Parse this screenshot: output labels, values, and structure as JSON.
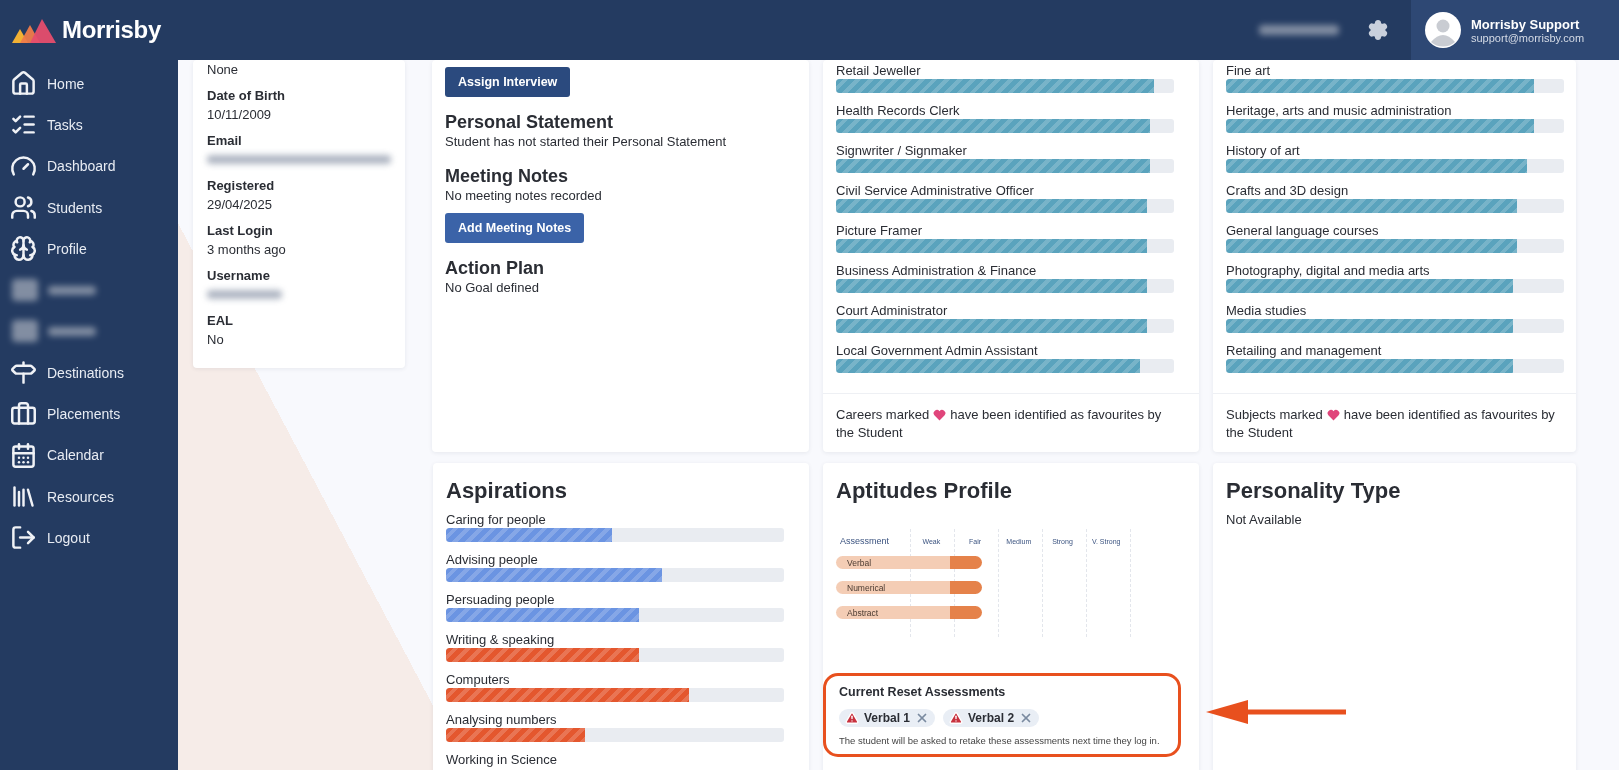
{
  "brand": {
    "name": "Morrisby"
  },
  "header": {
    "user_name": "Morrisby Support",
    "user_email": "support@morrisby.com"
  },
  "nav": [
    {
      "kind": "link",
      "label": "Home"
    },
    {
      "kind": "link",
      "label": "Tasks"
    },
    {
      "kind": "link",
      "label": "Dashboard"
    },
    {
      "kind": "link",
      "label": "Students"
    },
    {
      "kind": "link",
      "label": "Profile"
    },
    {
      "kind": "redacted"
    },
    {
      "kind": "redacted"
    },
    {
      "kind": "link",
      "label": "Destinations"
    },
    {
      "kind": "link",
      "label": "Placements"
    },
    {
      "kind": "link",
      "label": "Calendar"
    },
    {
      "kind": "link",
      "label": "Resources"
    },
    {
      "kind": "link",
      "label": "Logout"
    }
  ],
  "details": [
    {
      "value": "None"
    },
    {
      "label": "Date of Birth",
      "value": "10/11/2009"
    },
    {
      "label": "Email",
      "redacted": true
    },
    {
      "label": "Registered",
      "value": "29/04/2025"
    },
    {
      "label": "Last Login",
      "value": "3 months ago"
    },
    {
      "label": "Username",
      "redacted": true
    },
    {
      "label": "EAL",
      "value": "No"
    }
  ],
  "interview": {
    "button": "Assign Interview"
  },
  "sections": [
    {
      "title": "Personal Statement",
      "text": "Student has not started their Personal Statement"
    },
    {
      "title": "Meeting Notes",
      "text": "No meeting notes recorded",
      "button": "Add Meeting Notes"
    },
    {
      "title": "Action Plan",
      "text": "No Goal defined"
    }
  ],
  "careers": {
    "items": [
      {
        "label": "Retail Jeweller",
        "level": 0.94
      },
      {
        "label": "Health Records Clerk",
        "level": 0.93
      },
      {
        "label": "Signwriter / Signmaker",
        "level": 0.93
      },
      {
        "label": "Civil Service Administrative Officer",
        "level": 0.92
      },
      {
        "label": "Picture Framer",
        "level": 0.92
      },
      {
        "label": "Business Administration & Finance",
        "level": 0.92
      },
      {
        "label": "Court Administrator",
        "level": 0.92
      },
      {
        "label": "Local Government Admin Assistant",
        "level": 0.9
      }
    ],
    "footnote": [
      "Careers marked",
      "have been identified as favourites by",
      "the Student"
    ]
  },
  "subjects": {
    "items": [
      {
        "label": "Fine art",
        "level": 0.91
      },
      {
        "label": "Heritage, arts and music administration",
        "level": 0.91
      },
      {
        "label": "History of art",
        "level": 0.89
      },
      {
        "label": "Crafts and 3D design",
        "level": 0.86
      },
      {
        "label": "General language courses",
        "level": 0.86
      },
      {
        "label": "Photography, digital and media arts",
        "level": 0.85
      },
      {
        "label": "Media studies",
        "level": 0.85
      },
      {
        "label": "Retailing and management",
        "level": 0.85
      }
    ],
    "footnote": [
      "Subjects marked",
      "have been identified as favourites by",
      "the Student"
    ]
  },
  "aspirations": {
    "title": "Aspirations",
    "items": [
      {
        "label": "Caring for people",
        "level": 0.49,
        "color": "#6b94e2"
      },
      {
        "label": "Advising people",
        "level": 0.64,
        "color": "#6b94e2"
      },
      {
        "label": "Persuading people",
        "level": 0.57,
        "color": "#6b94e2"
      },
      {
        "label": "Writing & speaking",
        "level": 0.57,
        "color": "#e4572e"
      },
      {
        "label": "Computers",
        "level": 0.72,
        "color": "#e4572e"
      },
      {
        "label": "Analysing numbers",
        "level": 0.41,
        "color": "#e4572e"
      },
      {
        "label": "Working in Science"
      }
    ]
  },
  "aptitudes": {
    "title": "Aptitudes Profile",
    "chart": {
      "header": "Assessment",
      "scale": [
        "Weak",
        "Fair",
        "Medium",
        "Strong",
        "V. Strong"
      ],
      "rows": [
        {
          "label": "Verbal",
          "level": 0.5
        },
        {
          "label": "Numerical",
          "level": 0.5
        },
        {
          "label": "Abstract",
          "level": 0.5
        }
      ]
    },
    "reset": {
      "title": "Current Reset Assessments",
      "chips": [
        {
          "label": "Verbal 1"
        },
        {
          "label": "Verbal 2"
        }
      ],
      "note": "The student will be asked to retake these assessments next time they log in."
    }
  },
  "personality": {
    "title": "Personality Type",
    "text": "Not Available"
  }
}
